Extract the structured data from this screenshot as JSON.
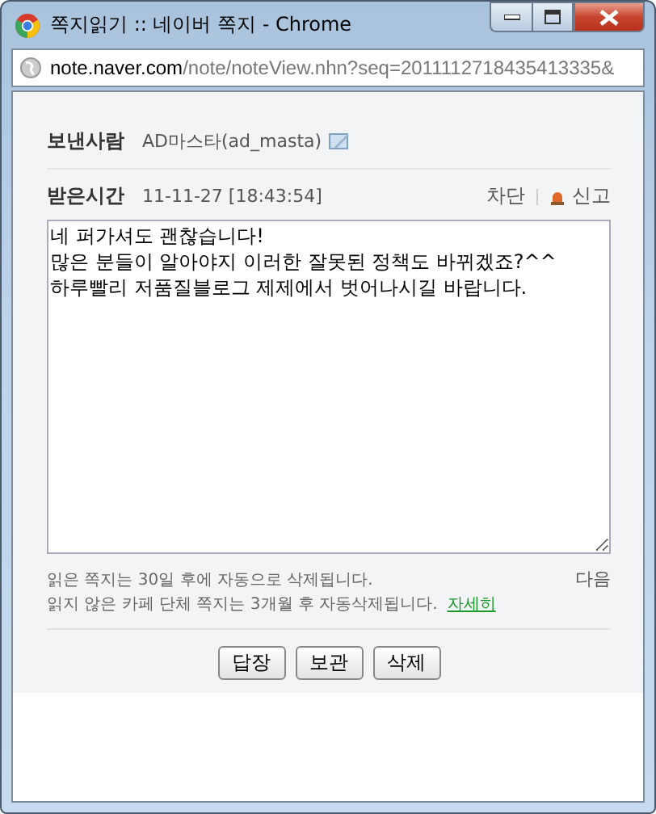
{
  "window": {
    "title": "쪽지읽기 :: 네이버 쪽지 - Chrome"
  },
  "address_bar": {
    "host": "note.naver.com",
    "path": "/note/noteView.nhn?seq=2011112718435413335&"
  },
  "sender": {
    "label": "보낸사람",
    "value": "AD마스타(ad_masta)"
  },
  "received": {
    "label": "받은시간",
    "value": "11-11-27 [18:43:54]"
  },
  "actions": [
    "차단",
    "신고"
  ],
  "message": {
    "value": "네 퍼가셔도 괜찮습니다!\n많은 분들이 알아야지 이러한 잘못된 정책도 바뀌겠죠?^^\n하루빨리 저품질블로그 제제에서 벗어나시길 바랍니다."
  },
  "notes": [
    "읽은 쪽지는 30일 후에 자동으로 삭제됩니다.",
    "읽지 않은 카페 단체 쪽지는 3개월 후 자동삭제됩니다."
  ],
  "details_link": "자세히",
  "next_link": "다음",
  "buttons": [
    "답장",
    "보관",
    "삭제"
  ]
}
